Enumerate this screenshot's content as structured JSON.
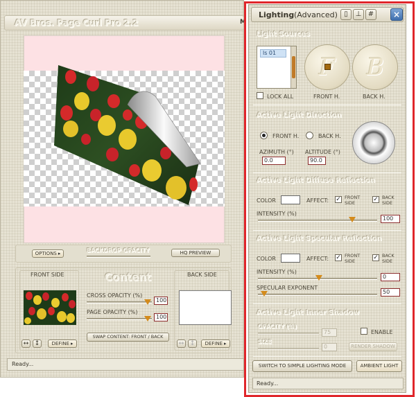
{
  "main": {
    "title": "AV Bros. Page Curl Pro 2.2",
    "title_right": "M",
    "options_label": "OPTIONS",
    "backdrop_opacity_label": "BACKDROP OPACITY",
    "hq_preview_label": "HQ PREVIEW",
    "front_side_label": "FRONT SIDE",
    "content_label": "Content",
    "back_side_label": "BACK SIDE",
    "cross_opacity_label": "CROSS OPACITY (%)",
    "cross_opacity_value": "100",
    "page_opacity_label": "PAGE OPACITY (%)",
    "page_opacity_value": "100",
    "swap_content_label": "SWAP CONTENT: FRONT / BACK",
    "define_label": "DEFINE",
    "status": "Ready..."
  },
  "lighting": {
    "title": "Lighting",
    "title_mode": "(Advanced)",
    "light_sources_label": "Light Sources",
    "source_item": "ls 01",
    "lock_all_label": "LOCK ALL",
    "front_h_label": "FRONT H.",
    "back_h_label": "BACK H.",
    "front_letter": "F",
    "back_letter": "B",
    "active_direction_label": "Active Light Direction",
    "radio_front": "FRONT H.",
    "radio_back": "BACK H.",
    "azimuth_label": "AZIMUTH (°)",
    "azimuth_value": "0.0",
    "altitude_label": "ALTITUDE (°)",
    "altitude_value": "90.0",
    "diffuse_label": "Active Light Diffuse Reflection",
    "color_label": "COLOR",
    "affect_label": "AFFECT:",
    "front_side": "FRONT SIDE",
    "back_side": "BACK SIDE",
    "intensity_label": "INTENSITY (%)",
    "diffuse_intensity": "100",
    "specular_label": "Active Light Specular Reflection",
    "specular_intensity": "0",
    "specular_exponent_label": "SPECULAR EXPONENT",
    "specular_exponent": "50",
    "shadow_label": "Active Light Inner Shadow",
    "opacity_label": "OPACITY (%)",
    "opacity_value": "75",
    "enable_label": "ENABLE",
    "size_label": "SIZE",
    "size_value": "0",
    "render_shadow_label": "RENDER SHADOW",
    "simple_mode_label": "SWITCH TO SIMPLE LIGHTING MODE",
    "ambient_label": "AMBIENT LIGHT",
    "status": "Ready...",
    "highlight_color": "#e0262b",
    "accent_color": "#d48b1c"
  }
}
